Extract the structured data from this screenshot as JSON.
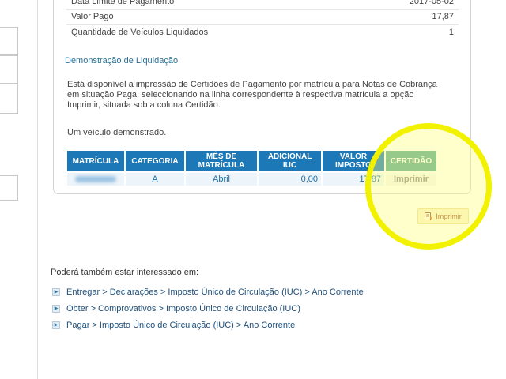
{
  "summary": {
    "rows": [
      {
        "label": "Data Limite de Pagamento",
        "value": "2017-05-02"
      },
      {
        "label": "Valor Pago",
        "value": "17,87"
      },
      {
        "label": "Quantidade de Veículos Liquidados",
        "value": "1"
      }
    ]
  },
  "settlement": {
    "title": "Demonstração de Liquidação",
    "description": "Está disponível a impressão de Certidões de Pagamento por matrícula para Notas de Cobrança em situação Paga, seleccionando na linha correspondente à respectiva matrícula a opção Imprimir, situada sob a coluna Certidão.",
    "vehicles_count": "Um veículo demonstrado."
  },
  "table": {
    "headers": {
      "plate": "MATRÍCULA",
      "category": "CATEGORIA",
      "month": "MÊS DE MATRÍCULA",
      "additional": "ADICIONAL IUC",
      "tax": "VALOR IMPOSTO",
      "certificate": "CERTIDÃO"
    },
    "row": {
      "category": "A",
      "month": "Abril",
      "additional": "0,00",
      "tax": "17,87",
      "certificate": "Imprimir"
    }
  },
  "print_button": {
    "label": "Imprimir",
    "icon": "print-icon"
  },
  "related": {
    "title": "Poderá também estar interessado em:",
    "links": [
      "Entregar > Declarações > Imposto Único de Circulação (IUC) > Ano Corrente",
      "Obter > Comprovativos > Imposto Único de Circulação (IUC)",
      "Pagar > Imposto Único de Circulação (IUC) > Ano Corrente"
    ]
  },
  "colors": {
    "header_blue": "#1c78b7",
    "certificate_green": "#58aa95",
    "link_blue": "#1f4f7a",
    "highlight_yellow": "#f2f200"
  }
}
